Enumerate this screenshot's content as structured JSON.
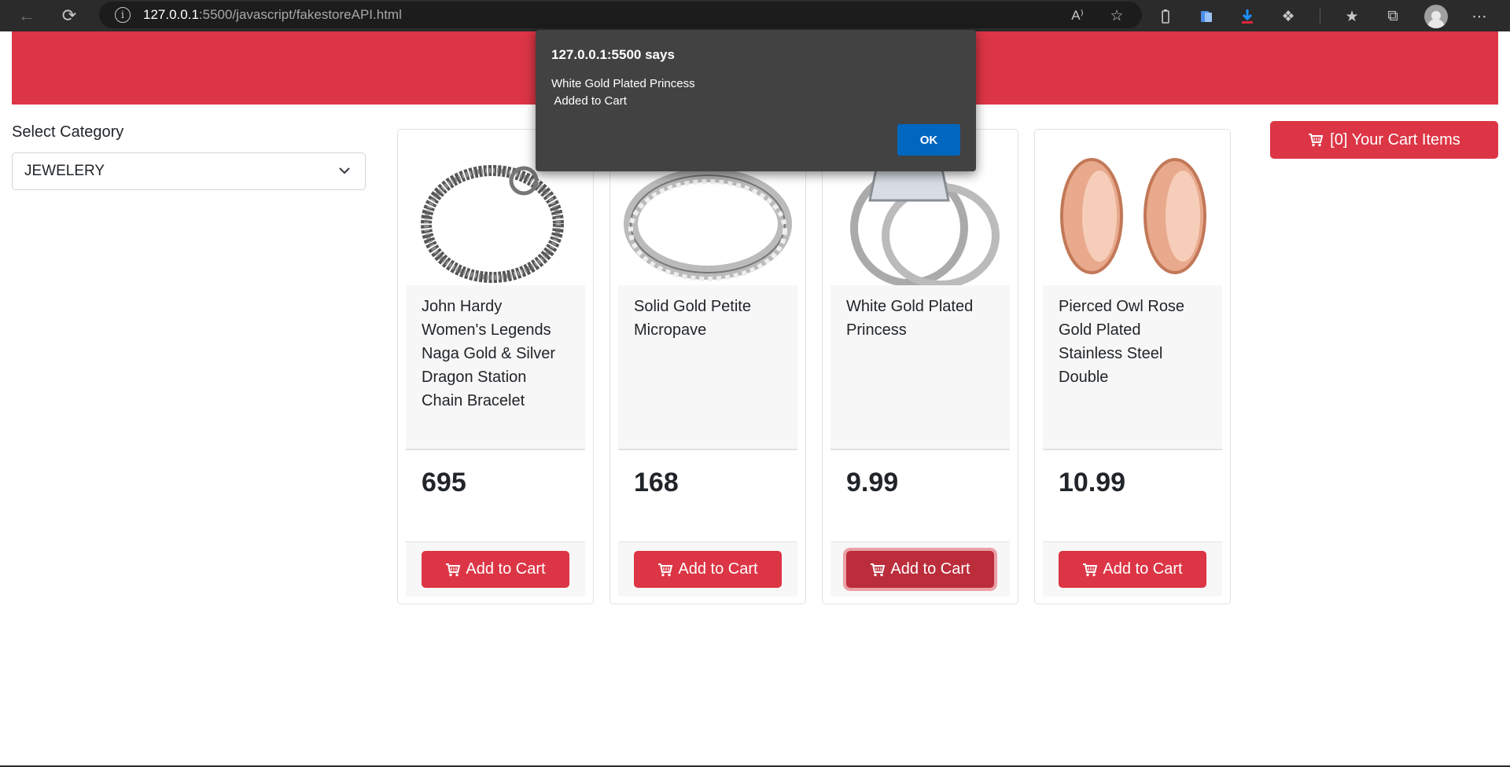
{
  "browser": {
    "url_host": "127.0.0.1",
    "url_rest": ":5500/javascript/fakestoreAPI.html",
    "icons": [
      "back-icon",
      "reload-icon",
      "info-icon",
      "read-aloud-icon",
      "favorite-add-icon",
      "battery-icon",
      "extension-icon",
      "download-icon",
      "puzzle-icon",
      "favorites-icon",
      "collections-icon",
      "profile-icon",
      "more-icon"
    ]
  },
  "sidebar": {
    "label": "Select Category",
    "selected": "JEWELERY"
  },
  "cart": {
    "label": "[0] Your Cart Items"
  },
  "products": [
    {
      "title": "John Hardy Women's Legends Naga Gold & Silver Dragon Station Chain Bracelet",
      "price": "695",
      "button": "Add to Cart",
      "image": "bracelet"
    },
    {
      "title": "Solid Gold Petite Micropave",
      "price": "168",
      "button": "Add to Cart",
      "image": "ring"
    },
    {
      "title": "White Gold Plated Princess",
      "price": "9.99",
      "button": "Add to Cart",
      "image": "ring-set"
    },
    {
      "title": "Pierced Owl Rose Gold Plated Stainless Steel Double",
      "price": "10.99",
      "button": "Add to Cart",
      "image": "earrings"
    }
  ],
  "dialog": {
    "title": "127.0.0.1:5500 says",
    "message": "White Gold Plated Princess\n Added to Cart",
    "ok": "OK"
  },
  "colors": {
    "brand": "#dc3545",
    "dialog_bg": "#424242",
    "ok_button": "#0067c0"
  }
}
